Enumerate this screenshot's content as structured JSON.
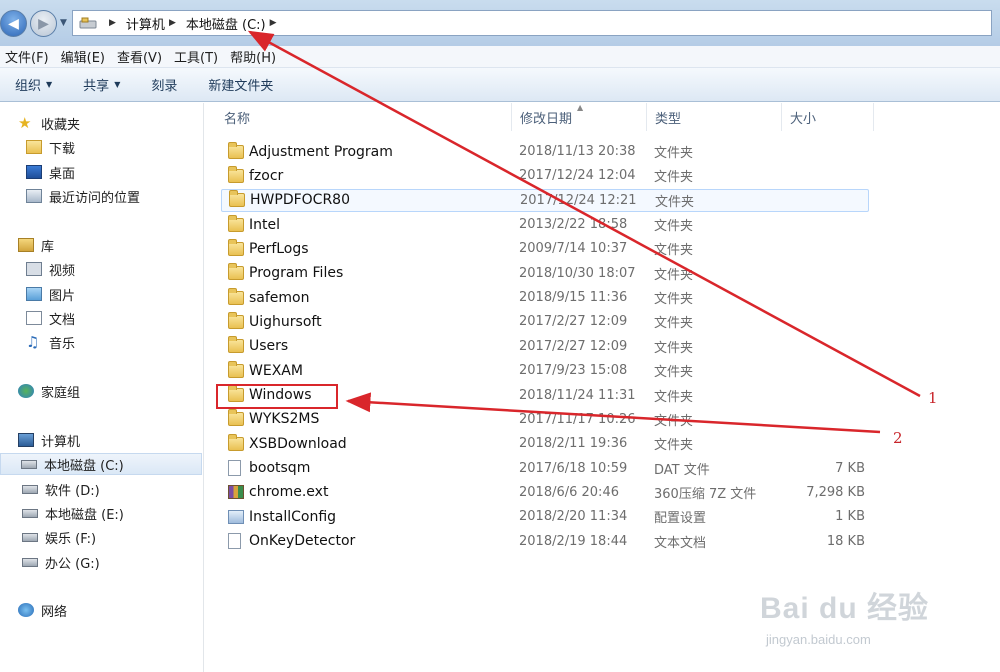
{
  "address": {
    "crumbs": [
      "计算机",
      "本地磁盘 (C:)"
    ]
  },
  "menu": [
    "文件(F)",
    "编辑(E)",
    "查看(V)",
    "工具(T)",
    "帮助(H)"
  ],
  "toolbar": {
    "organize": "组织",
    "share": "共享",
    "burn": "刻录",
    "new_folder": "新建文件夹"
  },
  "sidebar": {
    "favorites": "收藏夹",
    "downloads": "下载",
    "desktop": "桌面",
    "recent": "最近访问的位置",
    "libraries": "库",
    "videos": "视频",
    "pictures": "图片",
    "documents": "文档",
    "music": "音乐",
    "homegroup": "家庭组",
    "computer": "计算机",
    "drive_c": "本地磁盘 (C:)",
    "drive_d": "软件 (D:)",
    "drive_e": "本地磁盘 (E:)",
    "drive_f": "娱乐 (F:)",
    "drive_g": "办公 (G:)",
    "network": "网络"
  },
  "columns": {
    "name": "名称",
    "modified": "修改日期",
    "type": "类型",
    "size": "大小"
  },
  "files": [
    {
      "name": "Adjustment Program",
      "date": "2018/11/13 20:38",
      "type": "文件夹",
      "size": "",
      "icon": "folder-icon"
    },
    {
      "name": "fzocr",
      "date": "2017/12/24 12:04",
      "type": "文件夹",
      "size": "",
      "icon": "folder-icon"
    },
    {
      "name": "HWPDFOCR80",
      "date": "2017/12/24 12:21",
      "type": "文件夹",
      "size": "",
      "icon": "folder-icon"
    },
    {
      "name": "Intel",
      "date": "2013/2/22 18:58",
      "type": "文件夹",
      "size": "",
      "icon": "folder-icon"
    },
    {
      "name": "PerfLogs",
      "date": "2009/7/14 10:37",
      "type": "文件夹",
      "size": "",
      "icon": "folder-icon"
    },
    {
      "name": "Program Files",
      "date": "2018/10/30 18:07",
      "type": "文件夹",
      "size": "",
      "icon": "folder-icon"
    },
    {
      "name": "safemon",
      "date": "2018/9/15 11:36",
      "type": "文件夹",
      "size": "",
      "icon": "folder-icon"
    },
    {
      "name": "Uighursoft",
      "date": "2017/2/27 12:09",
      "type": "文件夹",
      "size": "",
      "icon": "folder-icon"
    },
    {
      "name": "Users",
      "date": "2017/2/27 12:09",
      "type": "文件夹",
      "size": "",
      "icon": "folder-icon"
    },
    {
      "name": "WEXAM",
      "date": "2017/9/23 15:08",
      "type": "文件夹",
      "size": "",
      "icon": "folder-icon"
    },
    {
      "name": "Windows",
      "date": "2018/11/24 11:31",
      "type": "文件夹",
      "size": "",
      "icon": "folder-icon"
    },
    {
      "name": "WYKS2MS",
      "date": "2017/11/17 10:26",
      "type": "文件夹",
      "size": "",
      "icon": "folder-icon"
    },
    {
      "name": "XSBDownload",
      "date": "2018/2/11 19:36",
      "type": "文件夹",
      "size": "",
      "icon": "folder-icon"
    },
    {
      "name": "bootsqm",
      "date": "2017/6/18 10:59",
      "type": "DAT 文件",
      "size": "7 KB",
      "icon": "file-icon"
    },
    {
      "name": "chrome.ext",
      "date": "2018/6/6 20:46",
      "type": "360压缩 7Z 文件",
      "size": "7,298 KB",
      "icon": "archive-icon"
    },
    {
      "name": "InstallConfig",
      "date": "2018/2/20 11:34",
      "type": "配置设置",
      "size": "1 KB",
      "icon": "settings-file-icon"
    },
    {
      "name": "OnKeyDetector",
      "date": "2018/2/19 18:44",
      "type": "文本文档",
      "size": "18 KB",
      "icon": "text-file-icon"
    }
  ],
  "annotations": {
    "label_1": "1",
    "label_2": "2",
    "accent": "#d9262b"
  },
  "watermark": {
    "main": "Bai du 经验",
    "sub": "jingyan.baidu.com"
  }
}
